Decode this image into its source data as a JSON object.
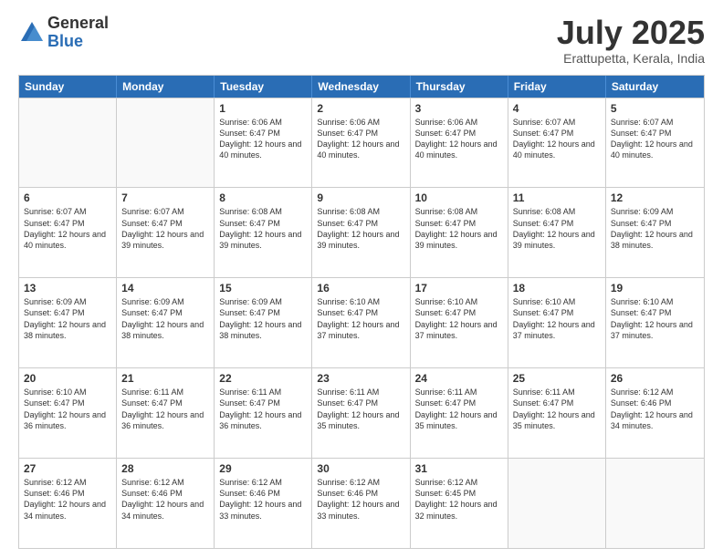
{
  "logo": {
    "general": "General",
    "blue": "Blue"
  },
  "header": {
    "month": "July 2025",
    "location": "Erattupetta, Kerala, India"
  },
  "weekdays": [
    "Sunday",
    "Monday",
    "Tuesday",
    "Wednesday",
    "Thursday",
    "Friday",
    "Saturday"
  ],
  "rows": [
    [
      {
        "date": "",
        "empty": true
      },
      {
        "date": "",
        "empty": true
      },
      {
        "date": "1",
        "sunrise": "Sunrise: 6:06 AM",
        "sunset": "Sunset: 6:47 PM",
        "daylight": "Daylight: 12 hours and 40 minutes."
      },
      {
        "date": "2",
        "sunrise": "Sunrise: 6:06 AM",
        "sunset": "Sunset: 6:47 PM",
        "daylight": "Daylight: 12 hours and 40 minutes."
      },
      {
        "date": "3",
        "sunrise": "Sunrise: 6:06 AM",
        "sunset": "Sunset: 6:47 PM",
        "daylight": "Daylight: 12 hours and 40 minutes."
      },
      {
        "date": "4",
        "sunrise": "Sunrise: 6:07 AM",
        "sunset": "Sunset: 6:47 PM",
        "daylight": "Daylight: 12 hours and 40 minutes."
      },
      {
        "date": "5",
        "sunrise": "Sunrise: 6:07 AM",
        "sunset": "Sunset: 6:47 PM",
        "daylight": "Daylight: 12 hours and 40 minutes."
      }
    ],
    [
      {
        "date": "6",
        "sunrise": "Sunrise: 6:07 AM",
        "sunset": "Sunset: 6:47 PM",
        "daylight": "Daylight: 12 hours and 40 minutes."
      },
      {
        "date": "7",
        "sunrise": "Sunrise: 6:07 AM",
        "sunset": "Sunset: 6:47 PM",
        "daylight": "Daylight: 12 hours and 39 minutes."
      },
      {
        "date": "8",
        "sunrise": "Sunrise: 6:08 AM",
        "sunset": "Sunset: 6:47 PM",
        "daylight": "Daylight: 12 hours and 39 minutes."
      },
      {
        "date": "9",
        "sunrise": "Sunrise: 6:08 AM",
        "sunset": "Sunset: 6:47 PM",
        "daylight": "Daylight: 12 hours and 39 minutes."
      },
      {
        "date": "10",
        "sunrise": "Sunrise: 6:08 AM",
        "sunset": "Sunset: 6:47 PM",
        "daylight": "Daylight: 12 hours and 39 minutes."
      },
      {
        "date": "11",
        "sunrise": "Sunrise: 6:08 AM",
        "sunset": "Sunset: 6:47 PM",
        "daylight": "Daylight: 12 hours and 39 minutes."
      },
      {
        "date": "12",
        "sunrise": "Sunrise: 6:09 AM",
        "sunset": "Sunset: 6:47 PM",
        "daylight": "Daylight: 12 hours and 38 minutes."
      }
    ],
    [
      {
        "date": "13",
        "sunrise": "Sunrise: 6:09 AM",
        "sunset": "Sunset: 6:47 PM",
        "daylight": "Daylight: 12 hours and 38 minutes."
      },
      {
        "date": "14",
        "sunrise": "Sunrise: 6:09 AM",
        "sunset": "Sunset: 6:47 PM",
        "daylight": "Daylight: 12 hours and 38 minutes."
      },
      {
        "date": "15",
        "sunrise": "Sunrise: 6:09 AM",
        "sunset": "Sunset: 6:47 PM",
        "daylight": "Daylight: 12 hours and 38 minutes."
      },
      {
        "date": "16",
        "sunrise": "Sunrise: 6:10 AM",
        "sunset": "Sunset: 6:47 PM",
        "daylight": "Daylight: 12 hours and 37 minutes."
      },
      {
        "date": "17",
        "sunrise": "Sunrise: 6:10 AM",
        "sunset": "Sunset: 6:47 PM",
        "daylight": "Daylight: 12 hours and 37 minutes."
      },
      {
        "date": "18",
        "sunrise": "Sunrise: 6:10 AM",
        "sunset": "Sunset: 6:47 PM",
        "daylight": "Daylight: 12 hours and 37 minutes."
      },
      {
        "date": "19",
        "sunrise": "Sunrise: 6:10 AM",
        "sunset": "Sunset: 6:47 PM",
        "daylight": "Daylight: 12 hours and 37 minutes."
      }
    ],
    [
      {
        "date": "20",
        "sunrise": "Sunrise: 6:10 AM",
        "sunset": "Sunset: 6:47 PM",
        "daylight": "Daylight: 12 hours and 36 minutes."
      },
      {
        "date": "21",
        "sunrise": "Sunrise: 6:11 AM",
        "sunset": "Sunset: 6:47 PM",
        "daylight": "Daylight: 12 hours and 36 minutes."
      },
      {
        "date": "22",
        "sunrise": "Sunrise: 6:11 AM",
        "sunset": "Sunset: 6:47 PM",
        "daylight": "Daylight: 12 hours and 36 minutes."
      },
      {
        "date": "23",
        "sunrise": "Sunrise: 6:11 AM",
        "sunset": "Sunset: 6:47 PM",
        "daylight": "Daylight: 12 hours and 35 minutes."
      },
      {
        "date": "24",
        "sunrise": "Sunrise: 6:11 AM",
        "sunset": "Sunset: 6:47 PM",
        "daylight": "Daylight: 12 hours and 35 minutes."
      },
      {
        "date": "25",
        "sunrise": "Sunrise: 6:11 AM",
        "sunset": "Sunset: 6:47 PM",
        "daylight": "Daylight: 12 hours and 35 minutes."
      },
      {
        "date": "26",
        "sunrise": "Sunrise: 6:12 AM",
        "sunset": "Sunset: 6:46 PM",
        "daylight": "Daylight: 12 hours and 34 minutes."
      }
    ],
    [
      {
        "date": "27",
        "sunrise": "Sunrise: 6:12 AM",
        "sunset": "Sunset: 6:46 PM",
        "daylight": "Daylight: 12 hours and 34 minutes."
      },
      {
        "date": "28",
        "sunrise": "Sunrise: 6:12 AM",
        "sunset": "Sunset: 6:46 PM",
        "daylight": "Daylight: 12 hours and 34 minutes."
      },
      {
        "date": "29",
        "sunrise": "Sunrise: 6:12 AM",
        "sunset": "Sunset: 6:46 PM",
        "daylight": "Daylight: 12 hours and 33 minutes."
      },
      {
        "date": "30",
        "sunrise": "Sunrise: 6:12 AM",
        "sunset": "Sunset: 6:46 PM",
        "daylight": "Daylight: 12 hours and 33 minutes."
      },
      {
        "date": "31",
        "sunrise": "Sunrise: 6:12 AM",
        "sunset": "Sunset: 6:45 PM",
        "daylight": "Daylight: 12 hours and 32 minutes."
      },
      {
        "date": "",
        "empty": true
      },
      {
        "date": "",
        "empty": true
      }
    ]
  ]
}
